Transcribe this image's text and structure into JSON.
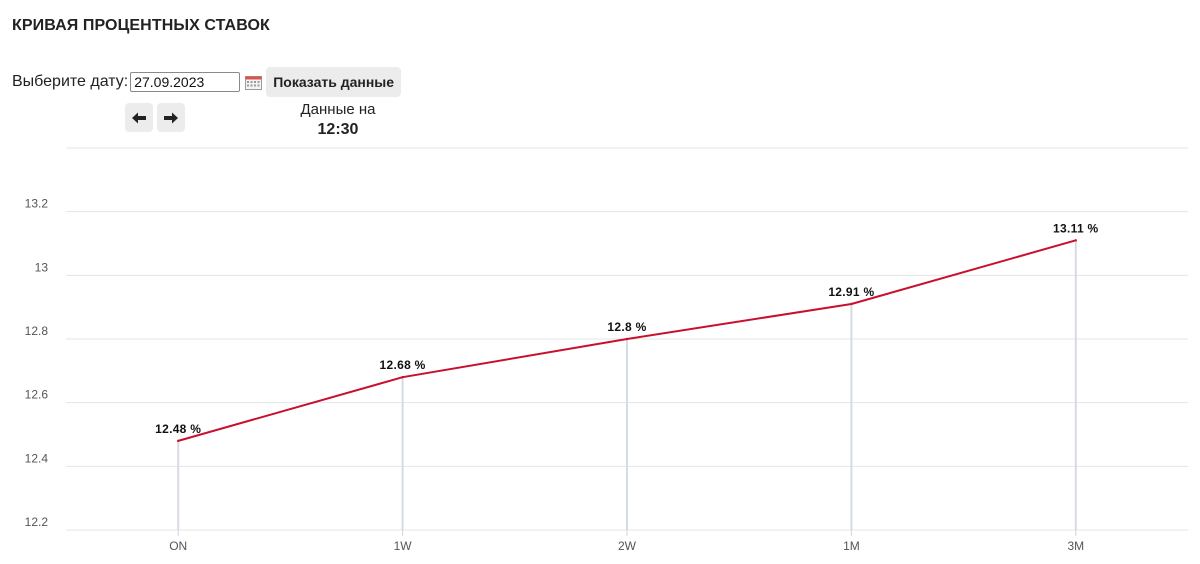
{
  "page": {
    "title": "КРИВАЯ ПРОЦЕНТНЫХ СТАВОК",
    "date_label": "Выберите дату:",
    "date_value": "27.09.2023",
    "show_button": "Показать данные",
    "data_as_of_label": "Данные на",
    "data_as_of_time": "12:30",
    "icons": {
      "calendar": "calendar-icon",
      "prev": "arrow-left-icon",
      "next": "arrow-right-icon"
    }
  },
  "chart_data": {
    "type": "line",
    "title": "",
    "xlabel": "",
    "ylabel": "",
    "categories": [
      "ON",
      "1W",
      "2W",
      "1M",
      "3M"
    ],
    "series": [
      {
        "values": [
          12.48,
          12.68,
          12.8,
          12.91,
          13.11
        ],
        "color": "#c8102e"
      }
    ],
    "data_labels": [
      "12.48 %",
      "12.68 %",
      "12.8 %",
      "12.91 %",
      "13.11 %"
    ],
    "yticks": [
      "12.2",
      "12.4",
      "12.6",
      "12.8",
      "13",
      "13.2"
    ],
    "ylim": [
      12.2,
      13.4
    ],
    "grid": true,
    "drop_lines": true
  }
}
